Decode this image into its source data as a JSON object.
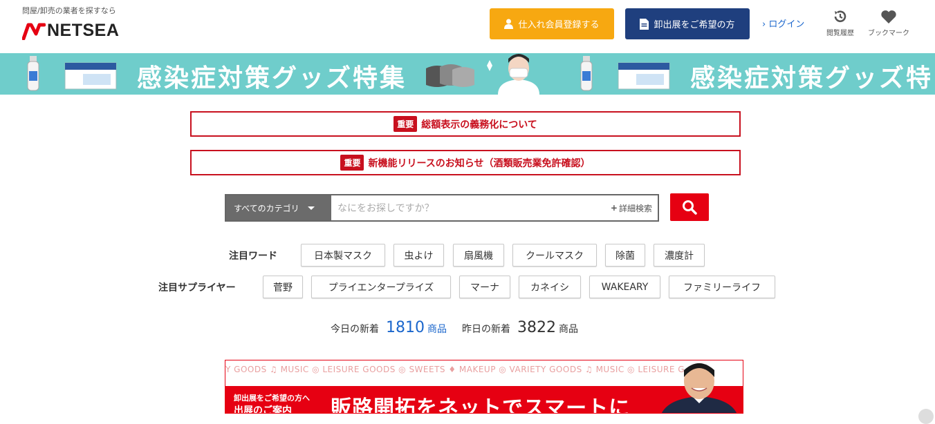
{
  "header": {
    "tagline": "問屋/卸売の業者を探すなら",
    "logo_text": "NETSEA",
    "member_button": "仕入れ会員登録する",
    "exhibit_button": "卸出展をご希望の方",
    "login_link": "ログイン",
    "history_label": "閲覧履歴",
    "bookmark_label": "ブックマーク"
  },
  "banner": {
    "title": "感染症対策グッズ特集",
    "title_repeat": "感染症対策グッズ特"
  },
  "notices": [
    {
      "tag": "重要",
      "text": "総額表示の義務化について"
    },
    {
      "tag": "重要",
      "text": "新機能リリースのお知らせ（酒類販売業免許確認）"
    }
  ],
  "search": {
    "category": "すべてのカテゴリ",
    "placeholder": "なにをお探しですか？",
    "advanced": "詳細検索"
  },
  "featured_words": {
    "label": "注目ワード",
    "items": [
      "日本製マスク",
      "虫よけ",
      "扇風機",
      "クールマスク",
      "除菌",
      "濃度計"
    ]
  },
  "featured_suppliers": {
    "label": "注目サプライヤー",
    "items": [
      "菅野",
      "プライエンタープライズ",
      "マーナ",
      "カネイシ",
      "WAKEARY",
      "ファミリーライフ"
    ]
  },
  "stats": {
    "today_label": "今日の新着",
    "today_count": "1810",
    "today_unit": "商品",
    "yesterday_label": "昨日の新着",
    "yesterday_count": "3822",
    "yesterday_unit": "商品"
  },
  "ad": {
    "categories_line": "Y GOODS ♫ MUSIC ◎ LEISURE GOODS ◎ SWEETS ♦ MAKEUP ◎ VARIETY GOODS ♫ MUSIC ◎ LEISURE G",
    "small_line1": "卸出展をご希望の方へ",
    "small_line2": "出展のご案内",
    "headline": "販路開拓をネットでスマートに"
  },
  "colors": {
    "accent_red": "#e60012",
    "orange": "#f7a811",
    "navy": "#1f3f7e",
    "banner_teal": "#6fcdcb",
    "link_blue": "#1a66cc"
  }
}
